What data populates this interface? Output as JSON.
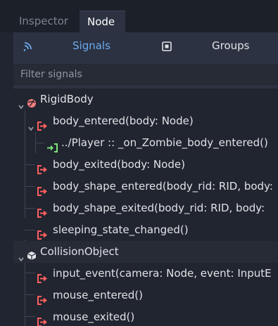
{
  "tabs": [
    {
      "label": "Inspector",
      "active": false
    },
    {
      "label": "Node",
      "active": true
    }
  ],
  "subtabs": {
    "signals_label": "Signals",
    "groups_label": "Groups"
  },
  "filter": {
    "placeholder": "Filter signals"
  },
  "tree": {
    "rigidbody": {
      "label": "RigidBody",
      "signals": [
        {
          "label": "body_entered(body: Node)",
          "expanded": true
        },
        {
          "label": "body_exited(body: Node)"
        },
        {
          "label": "body_shape_entered(body_rid: RID, body:"
        },
        {
          "label": "body_shape_exited(body_rid: RID, body:"
        },
        {
          "label": "sleeping_state_changed()"
        }
      ],
      "connection": {
        "label": "../Player :: _on_Zombie_body_entered()"
      }
    },
    "collision_object": {
      "label": "CollisionObject",
      "signals": [
        {
          "label": "input_event(camera: Node, event: InputE"
        },
        {
          "label": "mouse_entered()"
        },
        {
          "label": "mouse_exited()"
        }
      ]
    }
  },
  "colors": {
    "accent": "#6cabf2",
    "signal_icon": "#ff5f5f",
    "connection_icon": "#7ce47c",
    "rigidbody_icon": "#fc7f7f"
  }
}
